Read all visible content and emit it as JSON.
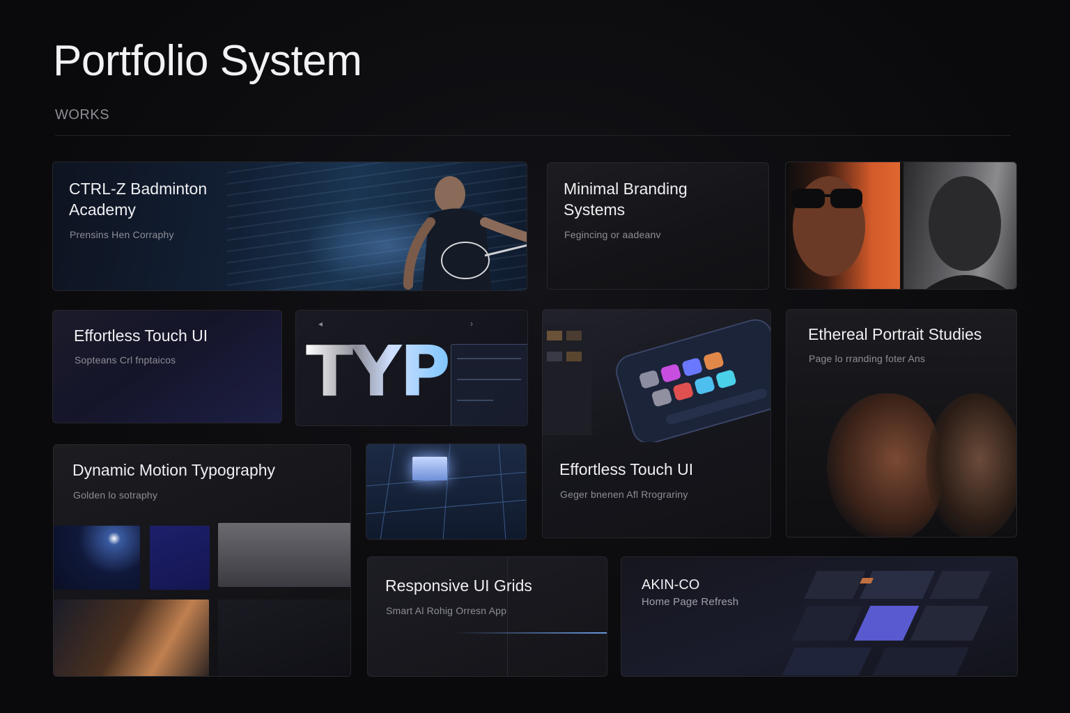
{
  "page": {
    "title": "Portfolio System",
    "section_label": "WORKS"
  },
  "cards": {
    "badminton": {
      "title_line1": "CTRL-Z Badminton",
      "title_line2": "Academy",
      "subtitle": "Prensins Hen Corraphy"
    },
    "branding": {
      "title_line1": "Minimal Branding",
      "title_line2": "Systems",
      "subtitle": "Fegincing or aadeanv"
    },
    "touch_small": {
      "title": "Effortless Touch UI",
      "subtitle": "Sopteans Crl fnptaicos"
    },
    "typ": {
      "display_text": "TYP",
      "arrow_left": "◂",
      "arrow_right": "›"
    },
    "touch_large": {
      "title": "Effortless Touch UI",
      "subtitle": "Geger bnenen Afl Rrograriny"
    },
    "ethereal": {
      "title": "Ethereal Portrait Studies",
      "subtitle": "Page lo rranding foter Ans"
    },
    "motion": {
      "title": "Dynamic Motion Typography",
      "subtitle": "Golden lo sotraphy"
    },
    "responsive": {
      "title": "Responsive UI Grids",
      "subtitle": "Smart Al Rohig Orresn App"
    },
    "akin": {
      "title": "AKIN-CO",
      "subtitle": "Home Page Refresh"
    }
  },
  "colors": {
    "background": "#0b0b0d",
    "card": "#18181c",
    "accent_orange": "#e0672f",
    "accent_blue": "#7fc6ff"
  }
}
